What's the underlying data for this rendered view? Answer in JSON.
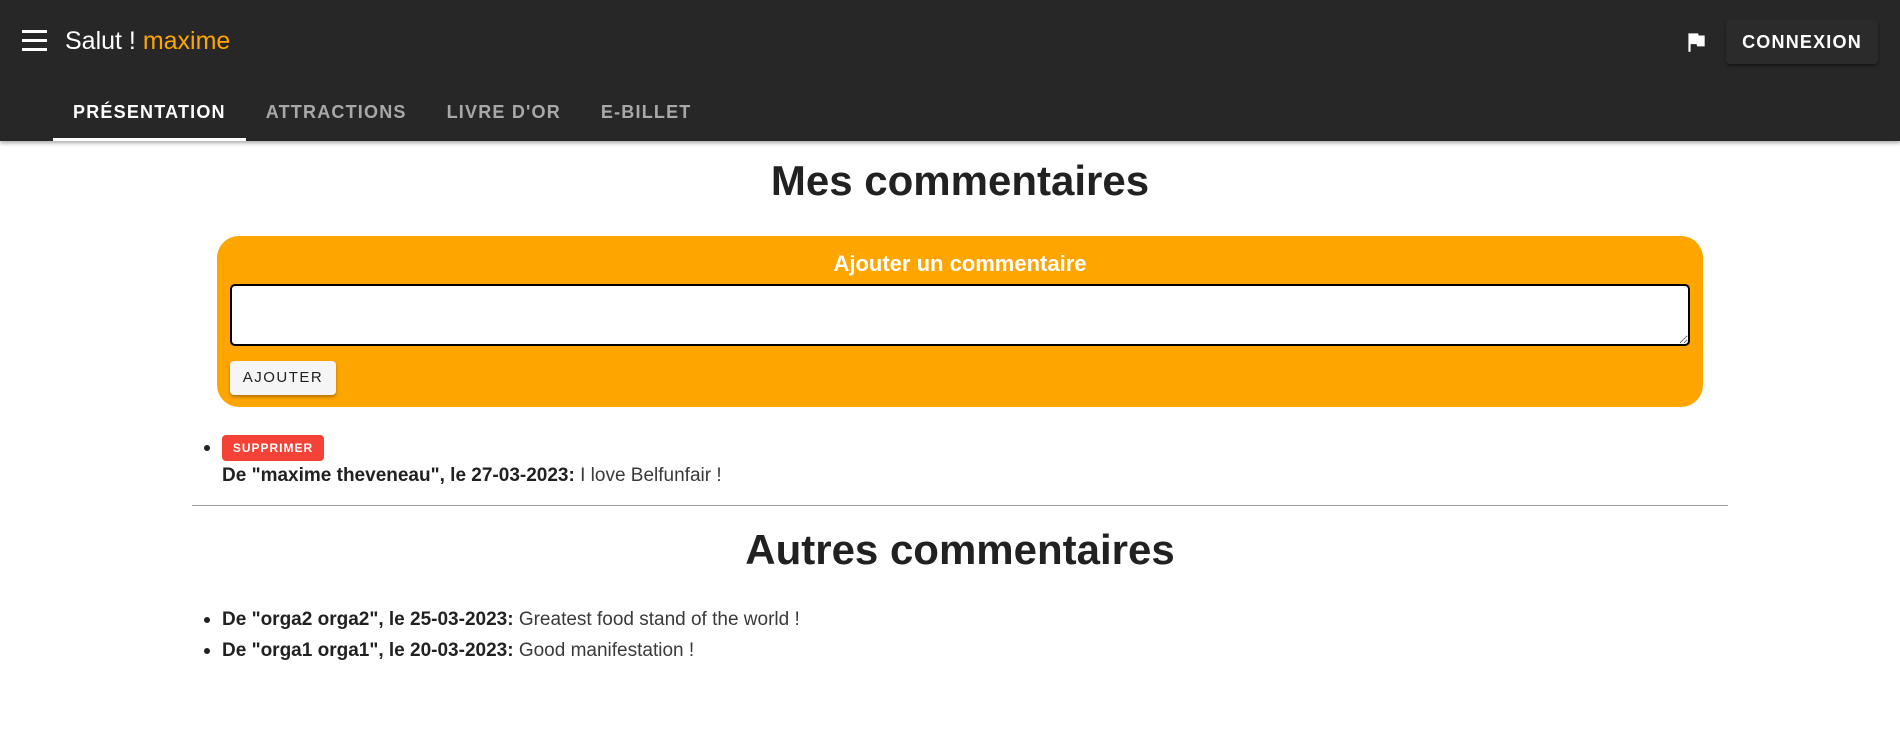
{
  "header": {
    "greeting": "Salut !",
    "username": "maxime",
    "login_label": "CONNEXION",
    "menu_icon": "menu-icon",
    "flag_icon": "flag-icon"
  },
  "tabs": [
    {
      "label": "PRÉSENTATION",
      "active": true
    },
    {
      "label": "ATTRACTIONS",
      "active": false
    },
    {
      "label": "LIVRE D'OR",
      "active": false
    },
    {
      "label": "E-BILLET",
      "active": false
    }
  ],
  "my_comments": {
    "title": "Mes commentaires",
    "form": {
      "title": "Ajouter un commentaire",
      "textarea_value": "",
      "add_label": "AJOUTER"
    },
    "items": [
      {
        "delete_label": "SUPPRIMER",
        "meta": "De \"maxime theveneau\", le 27-03-2023:",
        "text": "I love Belfunfair !"
      }
    ]
  },
  "other_comments": {
    "title": "Autres commentaires",
    "items": [
      {
        "meta": "De \"orga2 orga2\", le 25-03-2023:",
        "text": "Greatest food stand of the world !"
      },
      {
        "meta": "De \"orga1 orga1\", le 20-03-2023:",
        "text": "Good manifestation !"
      }
    ]
  },
  "colors": {
    "app_bar": "#272727",
    "accent": "#ffa500",
    "delete": "#f44336"
  }
}
